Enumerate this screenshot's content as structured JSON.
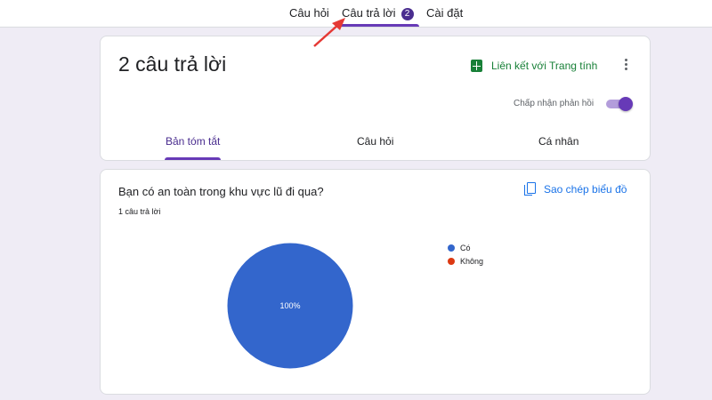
{
  "topbar": {
    "tabs": [
      {
        "label": "Câu hỏi"
      },
      {
        "label": "Câu trả lời",
        "badge": "2",
        "active": true
      },
      {
        "label": "Cài đặt"
      }
    ]
  },
  "summary": {
    "title": "2 câu trả lời",
    "sheet_link": "Liên kết với Trang tính",
    "accept_label": "Chấp nhận phản hồi",
    "accepting": true,
    "subtabs": [
      {
        "label": "Bản tóm tắt",
        "active": true
      },
      {
        "label": "Câu hỏi"
      },
      {
        "label": "Cá nhân"
      }
    ]
  },
  "question_card": {
    "question": "Bạn có an toàn trong khu vực lũ đi qua?",
    "copy_chart": "Sao chép biểu đồ",
    "response_count": "1 câu trả lời"
  },
  "chart_data": {
    "type": "pie",
    "categories": [
      "Có",
      "Không"
    ],
    "values": [
      100,
      0
    ],
    "slice_labels": [
      "100%",
      ""
    ],
    "colors": [
      "#3366cc",
      "#dc3912"
    ],
    "legend": "right"
  },
  "colors": {
    "accent": "#673ab7",
    "sheets_green": "#188038",
    "link_blue": "#1a73e8"
  },
  "icons": {
    "sheet": "google-sheets-icon",
    "more": "more-vert-icon",
    "copy": "copy-icon"
  }
}
